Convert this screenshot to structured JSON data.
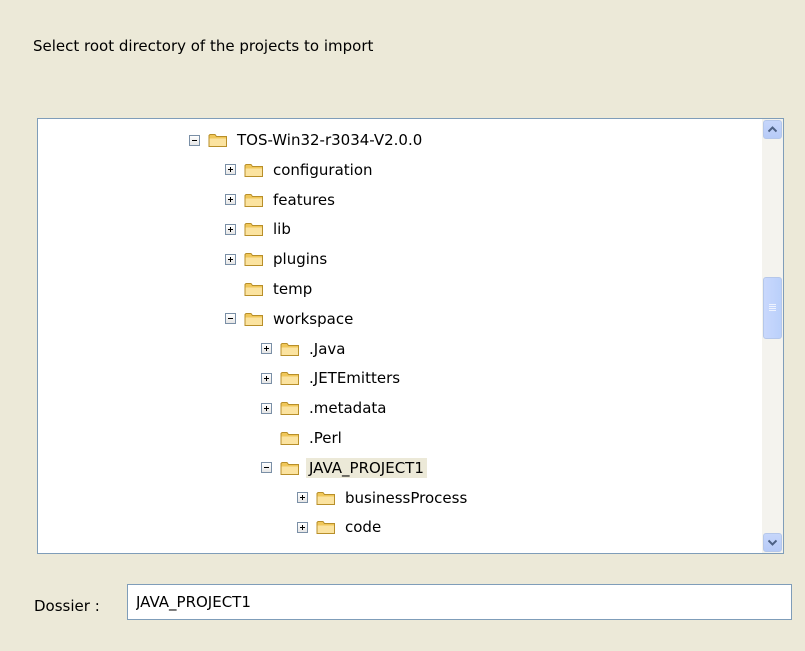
{
  "instruction": "Select root directory of the projects to import",
  "tree": {
    "items": [
      {
        "label": "TOS-Win32-r3034-V2.0.0",
        "expander": "minus"
      },
      {
        "label": "configuration",
        "expander": "plus"
      },
      {
        "label": "features",
        "expander": "plus"
      },
      {
        "label": "lib",
        "expander": "plus"
      },
      {
        "label": "plugins",
        "expander": "plus"
      },
      {
        "label": "temp",
        "expander": "none"
      },
      {
        "label": "workspace",
        "expander": "minus"
      },
      {
        "label": ".Java",
        "expander": "plus"
      },
      {
        "label": ".JETEmitters",
        "expander": "plus"
      },
      {
        "label": ".metadata",
        "expander": "plus"
      },
      {
        "label": ".Perl",
        "expander": "none"
      },
      {
        "label": "JAVA_PROJECT1",
        "expander": "minus",
        "selected": true
      },
      {
        "label": "businessProcess",
        "expander": "plus"
      },
      {
        "label": "code",
        "expander": "plus"
      }
    ]
  },
  "folder": {
    "label": "Dossier :",
    "value": "JAVA_PROJECT1"
  },
  "colors": {
    "background": "#ece9d8",
    "folder_fill": "#f5d67b",
    "scrollbar": "#c1d3fb"
  }
}
